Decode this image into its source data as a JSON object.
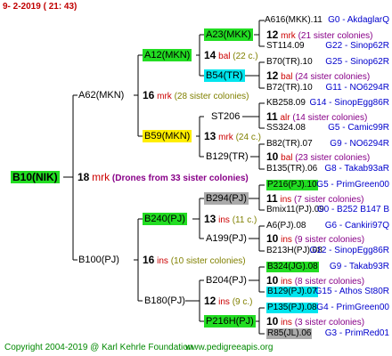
{
  "header": "9-  2-2019 ( 21: 43)",
  "root": {
    "label": "B10(NIK)",
    "num": "18",
    "mrk": "mrk",
    "note": "(Drones from 33 sister colonies)"
  },
  "g1": [
    {
      "label": "A62(MKN)",
      "num": "16",
      "mrk": "mrk",
      "note": "(28 sister colonies)"
    },
    {
      "label": "B100(PJ)",
      "num": "16",
      "mrk": "ins",
      "note": "(10 sister colonies)"
    }
  ],
  "g2": [
    {
      "label": "A12(MKN)",
      "num": "14",
      "mrk": "bal",
      "note": "(22 c.)"
    },
    {
      "label": "B59(MKN)",
      "num": "13",
      "mrk": "mrk",
      "note": "(24 c.)"
    },
    {
      "label": "B240(PJ)",
      "num": "13",
      "mrk": "ins",
      "note": "(11 c.)"
    },
    {
      "label": "B180(PJ)",
      "num": "12",
      "mrk": "ins",
      "note": "(9 c.)"
    }
  ],
  "g3": [
    {
      "label": "A23(MKK)",
      "num": "12",
      "mrk": "mrk",
      "note": "(21 sister colonies)"
    },
    {
      "label": "B54(TR)",
      "num": "12",
      "mrk": "bal",
      "note": "(24 sister colonies)"
    },
    {
      "label": "ST206",
      "num": "11",
      "mrk": "alr",
      "note": "(14 sister colonies)"
    },
    {
      "label": "B129(TR)",
      "num": "10",
      "mrk": "bal",
      "note": "(23 sister colonies)"
    },
    {
      "label": "B294(PJ)",
      "num": "11",
      "mrk": "ins",
      "note": "(7 sister colonies)"
    },
    {
      "label": "A199(PJ)",
      "num": "10",
      "mrk": "ins",
      "note": "(9 sister colonies)"
    },
    {
      "label": "B204(PJ)",
      "num": "10",
      "mrk": "ins",
      "note": "(8 sister colonies)"
    },
    {
      "label": "P216H(PJ)",
      "num": "10",
      "mrk": "ins",
      "note": "(3 sister colonies)"
    }
  ],
  "g4": [
    {
      "label": "A616(MKK).11",
      "info": "G0 - AkdaglarQ"
    },
    {
      "label": "ST114.09",
      "info": "G22 - Sinop62R"
    },
    {
      "label": "B70(TR).10",
      "info": "G25 - Sinop62R"
    },
    {
      "label": "B72(TR).10",
      "info": "G11 - NO6294R"
    },
    {
      "label": "KB258.09",
      "info": "G14 - SinopEgg86R"
    },
    {
      "label": "SS324.08",
      "info": "G5 - Camic99R"
    },
    {
      "label": "B82(TR).07",
      "info": "G9 - NO6294R"
    },
    {
      "label": "B135(TR).06",
      "info": "G8 - Takab93aR"
    },
    {
      "label": "P216(PJ).10",
      "info": "G5 - PrimGreen00"
    },
    {
      "label": "Bmix11(PJ).09",
      "info": "G0 - B252 B147 B"
    },
    {
      "label": "A6(PJ).08",
      "info": "G6 - Cankiri97Q"
    },
    {
      "label": "B213H(PJ).08",
      "info": "G12 - SinopEgg86R"
    },
    {
      "label": "B324(JG).08",
      "info": "G9 - Takab93R"
    },
    {
      "label": "B129(PJ).07",
      "info": "G15 - Athos St80R"
    },
    {
      "label": "P135(PJ).08",
      "info": "G4 - PrimGreen00"
    },
    {
      "label": "R85(JL).06",
      "info": "G3 - PrimRed01"
    }
  ],
  "footer": {
    "copyright": "Copyright 2004-2019 @ Karl Kehrle Foundation",
    "site": "www.pedigreeapis.org"
  }
}
